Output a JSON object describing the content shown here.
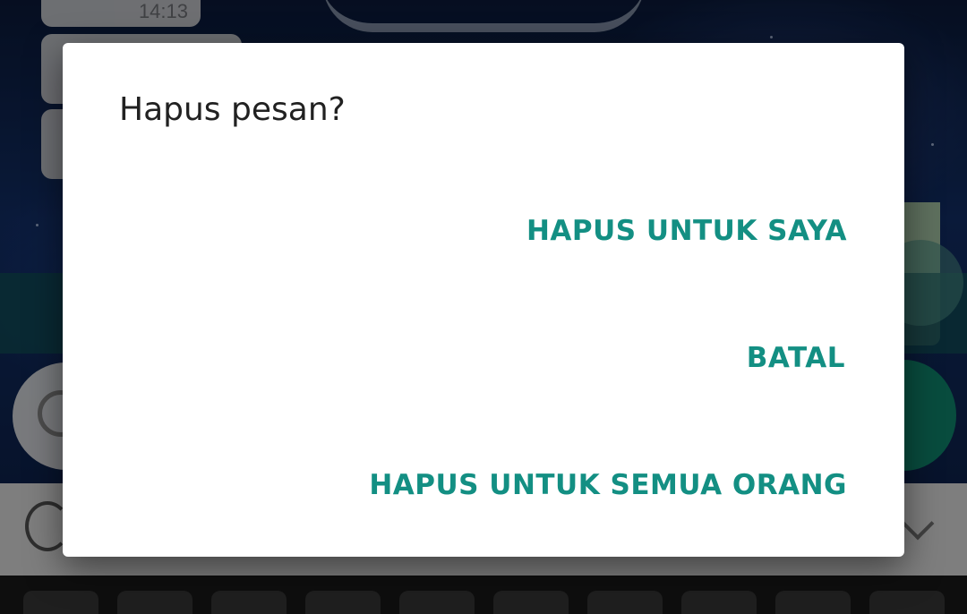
{
  "background": {
    "chat_bubble_time": "14:13",
    "colors": {
      "wallpaper": "#13306a",
      "input_strip": "#12505c",
      "mic_button": "#0f8a72",
      "keyboard_toolbar": "#e6e6e6"
    }
  },
  "dialog": {
    "title": "Hapus pesan?",
    "actions": {
      "delete_for_me": "HAPUS UNTUK SAYA",
      "cancel": "BATAL",
      "delete_for_everyone": "HAPUS UNTUK SEMUA ORANG"
    },
    "colors": {
      "accent": "#138f83",
      "title": "#212121",
      "surface": "#ffffff"
    }
  },
  "icons": {
    "emoji": "emoji-icon",
    "mic": "mic-icon",
    "edit": "edit-icon",
    "translate": "translate-icon",
    "collapse": "chevron-down-icon"
  }
}
